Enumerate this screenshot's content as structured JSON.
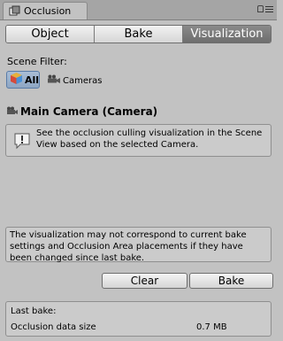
{
  "window": {
    "tab_title": "Occlusion"
  },
  "modes": {
    "object": "Object",
    "bake": "Bake",
    "visualization": "Visualization",
    "active": "visualization"
  },
  "scene_filter": {
    "label": "Scene Filter:",
    "all": "All",
    "cameras": "Cameras"
  },
  "camera": {
    "title": "Main Camera (Camera)"
  },
  "info": {
    "text": "See the occlusion culling visualization in the Scene View based on the selected Camera."
  },
  "warning": {
    "text": "The visualization may not correspond to current bake settings and Occlusion Area placements if they have been changed since last bake."
  },
  "buttons": {
    "clear": "Clear",
    "bake": "Bake"
  },
  "stats": {
    "last_bake_label": "Last bake:",
    "data_size_label": "Occlusion data size",
    "data_size_value": "0.7 MB"
  },
  "colors": {
    "panel_bg": "#c2c2c2",
    "active_segment": "#7b7b7b",
    "selected_filter": "#9eb3ce"
  }
}
